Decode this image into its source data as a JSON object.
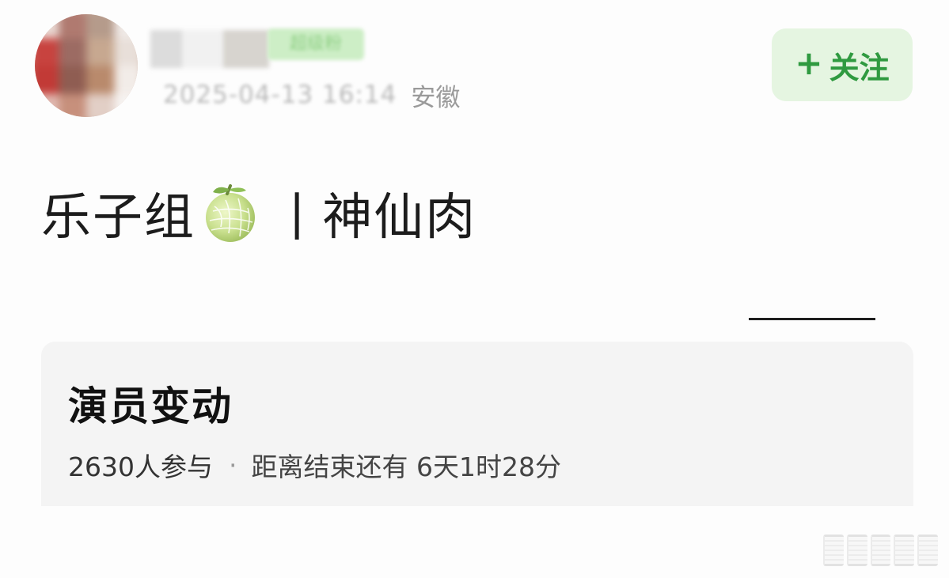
{
  "header": {
    "time_blurred": "2025-04-13 16:14",
    "location": "安徽",
    "level_badge": "超级粉",
    "follow": {
      "plus": "+",
      "label": "关注"
    }
  },
  "post": {
    "text_left": "乐子组",
    "emoji": "melon-icon",
    "separator": "|",
    "text_right": "神仙肉"
  },
  "vote_card": {
    "title": "演员变动",
    "participants": "2630人参与",
    "dot": "·",
    "remaining": "距离结束还有 6天1时28分"
  },
  "colors": {
    "accent_green": "#2f9a40",
    "follow_bg": "#e5f5e1",
    "card_bg": "#f4f4f4"
  }
}
